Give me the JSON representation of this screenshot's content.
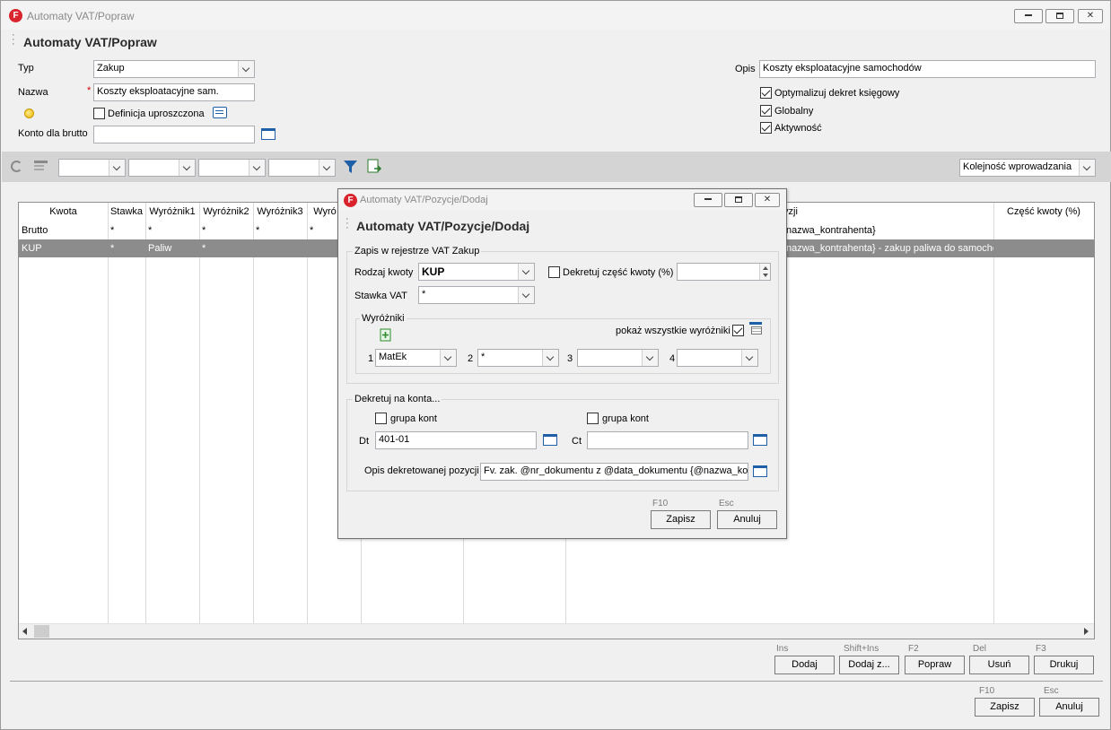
{
  "main_window": {
    "title": "Automaty VAT/Popraw",
    "header": "Automaty VAT/Popraw",
    "form": {
      "typ_label": "Typ",
      "typ_value": "Zakup",
      "nazwa_label": "Nazwa",
      "nazwa_required": "*",
      "nazwa_value": "Koszty eksploatacyjne sam.",
      "definicja_label": "Definicja uproszczona",
      "konto_label": "Konto dla brutto",
      "konto_value": "",
      "opis_label": "Opis",
      "opis_value": "Koszty eksploatacyjne samochodów",
      "optymalizuj_label": "Optymalizuj dekret księgowy",
      "globalny_label": "Globalny",
      "aktywnosc_label": "Aktywność"
    },
    "toolbar": {
      "sort_value": "Kolejność wprowadzania"
    },
    "grid": {
      "columns": [
        "Kwota",
        "Stawka",
        "Wyróżnik1",
        "Wyróżnik2",
        "Wyróżnik3",
        "Wyró",
        "yzji",
        "Część kwoty (%)"
      ],
      "rows": [
        {
          "kwota": "Brutto",
          "stawka": "*",
          "w1": "*",
          "w2": "*",
          "w3": "*",
          "w4": "*",
          "opis": "nazwa_kontrahenta}"
        },
        {
          "kwota": "KUP",
          "stawka": "*",
          "w1": "Paliw",
          "w2": "*",
          "w3": "",
          "w4": "",
          "opis": "nazwa_kontrahenta} - zakup paliwa do samochod"
        }
      ]
    },
    "buttons": {
      "dodaj": {
        "key": "Ins",
        "label": "Dodaj"
      },
      "dodaj_z": {
        "key": "Shift+Ins",
        "label": "Dodaj z..."
      },
      "popraw": {
        "key": "F2",
        "label": "Popraw"
      },
      "usun": {
        "key": "Del",
        "label": "Usuń"
      },
      "drukuj": {
        "key": "F3",
        "label": "Drukuj"
      },
      "zapisz": {
        "key": "F10",
        "label": "Zapisz"
      },
      "anuluj": {
        "key": "Esc",
        "label": "Anuluj"
      }
    }
  },
  "dialog": {
    "title": "Automaty VAT/Pozycje/Dodaj",
    "header": "Automaty VAT/Pozycje/Dodaj",
    "zapis_group": "Zapis w rejestrze VAT Zakup",
    "rodzaj_label": "Rodzaj kwoty",
    "rodzaj_value": "KUP",
    "dekretuj_czesc_label": "Dekretuj część kwoty (%)",
    "czesc_value": "",
    "stawka_label": "Stawka VAT",
    "stawka_value": "*",
    "wyrozniki_group": "Wyróżniki",
    "pokaz_label": "pokaż wszystkie wyróżniki",
    "wyrozniki": [
      {
        "num": "1",
        "value": "MatEk"
      },
      {
        "num": "2",
        "value": "*"
      },
      {
        "num": "3",
        "value": ""
      },
      {
        "num": "4",
        "value": ""
      }
    ],
    "dekretuj_group": "Dekretuj na konta...",
    "grupa_kont_label_dt": "grupa kont",
    "grupa_kont_label_ct": "grupa kont",
    "dt_label": "Dt",
    "dt_value": "401-01",
    "ct_label": "Ct",
    "ct_value": "",
    "opis_poz_label": "Opis dekretowanej pozycji",
    "opis_poz_value": "Fv. zak. @nr_dokumentu z @data_dokumentu {@nazwa_ko",
    "zapisz": {
      "key": "F10",
      "label": "Zapisz"
    },
    "anuluj": {
      "key": "Esc",
      "label": "Anuluj"
    }
  },
  "icons": {
    "app": "F"
  },
  "colors": {
    "app_icon": "#d9232d",
    "selected_row": "#8c8c8c",
    "folder": "#1f5fa8"
  }
}
